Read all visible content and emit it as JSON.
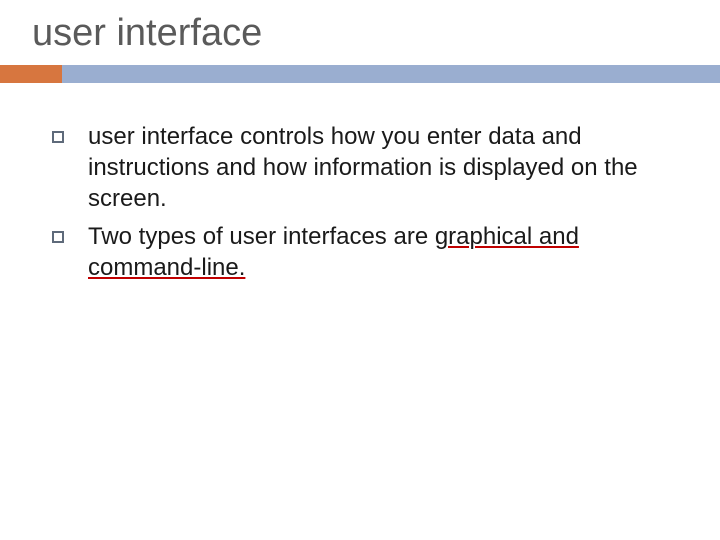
{
  "title": "user interface",
  "bullets": [
    {
      "pre": "user interface controls how you enter data and instructions and how information is displayed on the screen.",
      "highlight": "",
      "post": ""
    },
    {
      "pre": "Two types of user interfaces are ",
      "highlight": "graphical and command-line.",
      "post": ""
    }
  ]
}
